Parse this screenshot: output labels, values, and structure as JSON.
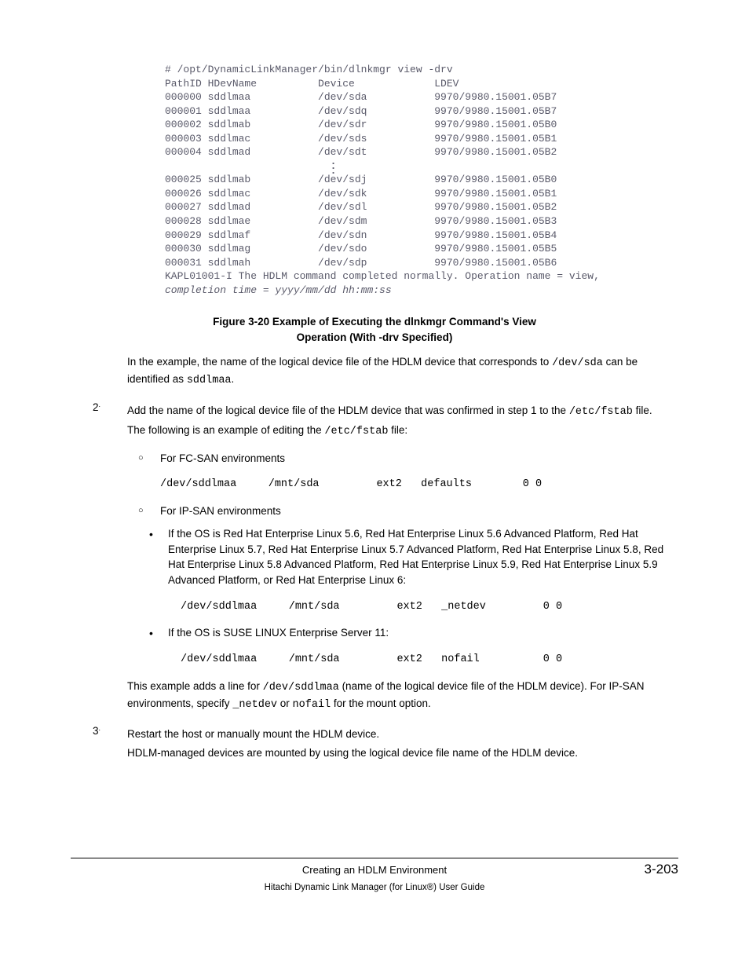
{
  "terminal": {
    "cmd": "# /opt/DynamicLinkManager/bin/dlnkmgr view -drv",
    "hdr": "PathID HDevName          Device             LDEV",
    "rows1": [
      "000000 sddlmaa           /dev/sda           9970/9980.15001.05B7",
      "000001 sddlmaa           /dev/sdq           9970/9980.15001.05B7",
      "000002 sddlmab           /dev/sdr           9970/9980.15001.05B0",
      "000003 sddlmac           /dev/sds           9970/9980.15001.05B1",
      "000004 sddlmad           /dev/sdt           9970/9980.15001.05B2"
    ],
    "rows2": [
      "000025 sddlmab           /dev/sdj           9970/9980.15001.05B0",
      "000026 sddlmac           /dev/sdk           9970/9980.15001.05B1",
      "000027 sddlmad           /dev/sdl           9970/9980.15001.05B2",
      "000028 sddlmae           /dev/sdm           9970/9980.15001.05B3",
      "000029 sddlmaf           /dev/sdn           9970/9980.15001.05B4",
      "000030 sddlmag           /dev/sdo           9970/9980.15001.05B5",
      "000031 sddlmah           /dev/sdp           9970/9980.15001.05B6"
    ],
    "msg1": "KAPL01001-I The HDLM command completed normally. Operation name = view,",
    "msg2": "completion time = yyyy/mm/dd hh:mm:ss"
  },
  "figcap_l1": "Figure 3-20 Example of Executing the dlnkmgr Command's View",
  "figcap_l2": "Operation (With -drv Specified)",
  "intro1_a": "In the example, the name of the logical device file of the HDLM device that corresponds to ",
  "intro1_code1": "/dev/sda",
  "intro1_b": " can be identified as ",
  "intro1_code2": "sddlmaa",
  "intro1_c": ".",
  "step2_num": "2",
  "step2_dot": ".",
  "step2_a": "Add the name of the logical device file of the HDLM device that was confirmed in step 1 to the ",
  "step2_code1": "/etc/fstab",
  "step2_b": " file.",
  "step2_ex_a": "The following is an example of editing the ",
  "step2_ex_code": "/etc/fstab",
  "step2_ex_b": " file:",
  "env_fc": "For FC-SAN environments",
  "code_fc": "/dev/sddlmaa     /mnt/sda         ext2   defaults        0 0",
  "env_ip": "For IP-SAN environments",
  "ip_rhel": "If the OS is Red Hat Enterprise Linux 5.6, Red Hat Enterprise Linux 5.6 Advanced Platform, Red Hat Enterprise Linux 5.7, Red Hat Enterprise Linux 5.7 Advanced Platform, Red Hat Enterprise Linux 5.8, Red Hat Enterprise Linux 5.8 Advanced Platform, Red Hat Enterprise Linux 5.9, Red Hat Enterprise Linux 5.9 Advanced Platform, or Red Hat Enterprise Linux 6:",
  "code_rhel": "/dev/sddlmaa     /mnt/sda         ext2   _netdev         0 0",
  "ip_suse": "If the OS is SUSE LINUX Enterprise Server 11:",
  "code_suse": "/dev/sddlmaa     /mnt/sda         ext2   nofail          0 0",
  "outro_a": "This example adds a line for ",
  "outro_code1": "/dev/sddlmaa",
  "outro_b": " (name of the logical device file of the HDLM device). For IP-SAN environments, specify ",
  "outro_code2": "_netdev",
  "outro_c": " or ",
  "outro_code3": "nofail",
  "outro_d": " for the mount option.",
  "step3_num": "3",
  "step3_dot": ".",
  "step3_a": "Restart the host or manually mount the HDLM device.",
  "step3_b": "HDLM-managed devices are mounted by using the logical device file name of the HDLM device.",
  "footer_section": "Creating an HDLM Environment",
  "footer_page": "3-203",
  "footer_doc": "Hitachi Dynamic Link Manager (for Linux®) User Guide"
}
